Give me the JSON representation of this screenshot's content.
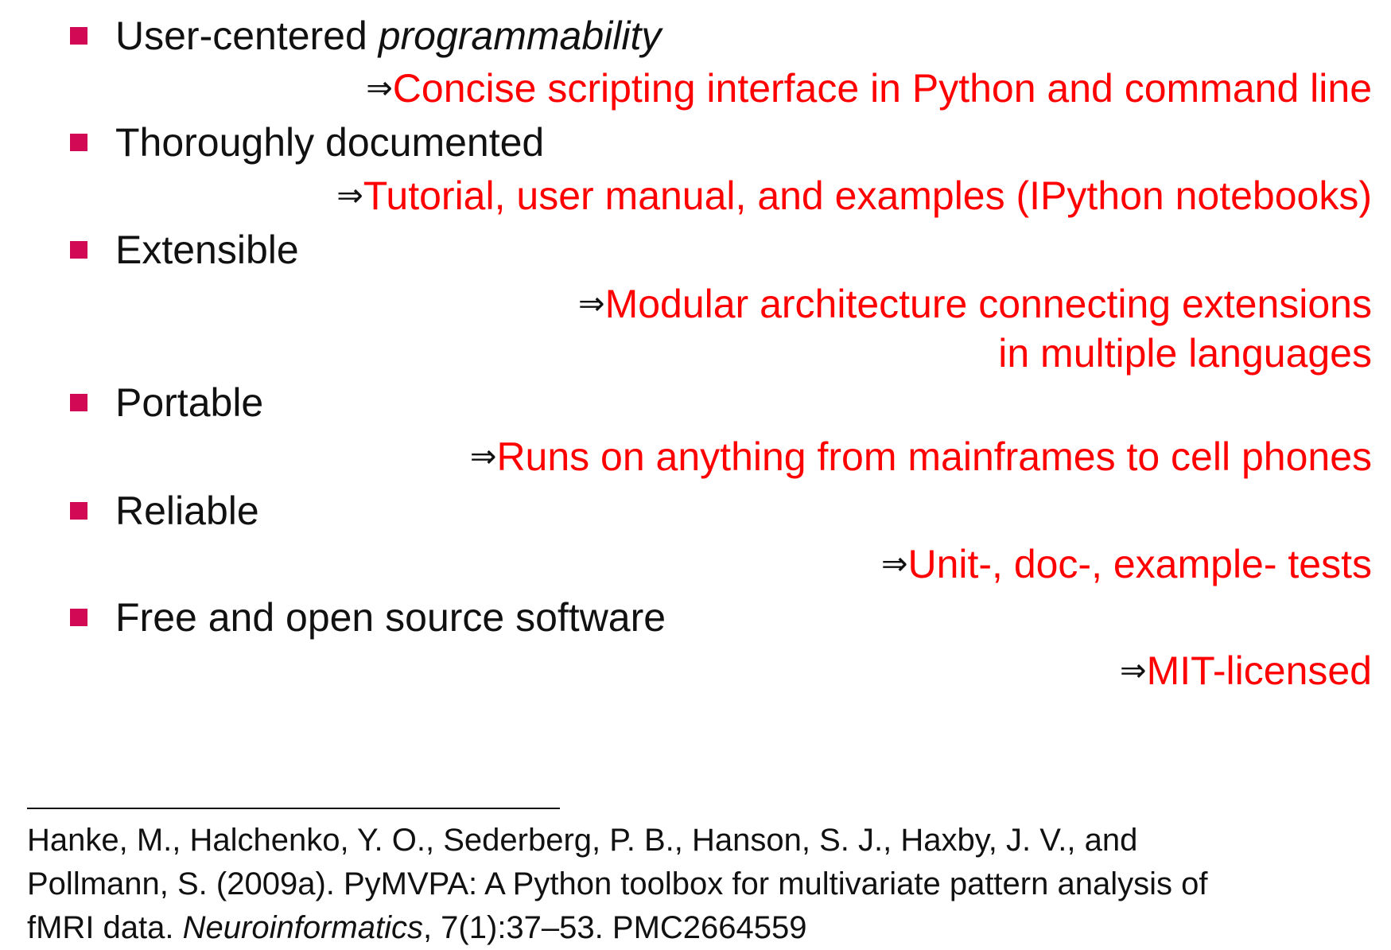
{
  "features": [
    {
      "label": "User-centered ",
      "label_emphasis": "programmability",
      "arrow": "⇒",
      "result_lines": [
        "Concise scripting interface in Python and command line"
      ]
    },
    {
      "label": "Thoroughly documented",
      "arrow": "⇒",
      "result_lines": [
        "Tutorial, user manual, and examples (IPython notebooks)"
      ]
    },
    {
      "label": "Extensible",
      "arrow": "⇒",
      "result_lines": [
        "Modular architecture connecting extensions",
        "in multiple languages"
      ]
    },
    {
      "label": "Portable",
      "arrow": "⇒",
      "result_lines": [
        "Runs on anything from mainframes to cell phones"
      ]
    },
    {
      "label": "Reliable",
      "arrow": "⇒",
      "result_lines": [
        "Unit-, doc-, example- tests"
      ]
    },
    {
      "label": "Free and open source software",
      "arrow": "⇒",
      "result_lines": [
        "MIT-licensed"
      ]
    }
  ],
  "citation": {
    "line1": "Hanke, M., Halchenko, Y. O., Sederberg, P. B., Hanson, S. J., Haxby, J. V., and",
    "line2": "Pollmann, S. (2009a). PyMVPA: A Python toolbox for multivariate pattern analysis of",
    "line3_before": "fMRI data. ",
    "journal": "Neuroinformatics",
    "line3_after": ", 7(1):37–53. PMC2664559"
  },
  "colors": {
    "bullet": "#d20a55",
    "result_text": "#ff0000",
    "body_text": "#111111",
    "background": "#ffffff"
  }
}
